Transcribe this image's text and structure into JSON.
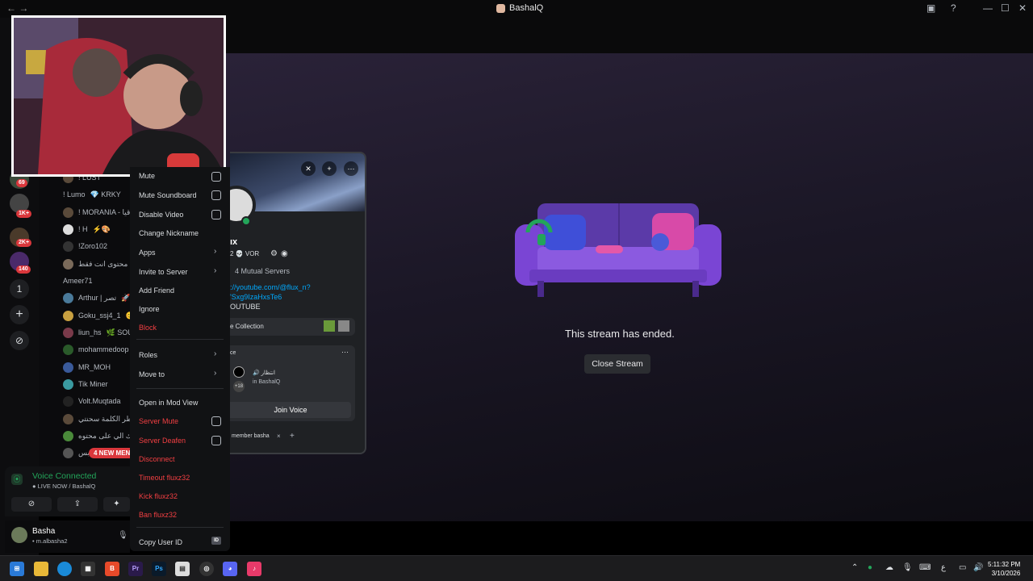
{
  "window": {
    "title": "BashalQ",
    "nav_back": "←",
    "nav_fwd": "→",
    "help": "?",
    "minimize": "—",
    "maximize": "☐",
    "close": "✕"
  },
  "server_rail": {
    "badges": [
      "69",
      "1K+",
      "2K+",
      "140"
    ],
    "home_number": "1",
    "add": "+",
    "explore": "⊘"
  },
  "members": [
    {
      "name": "! LUST"
    },
    {
      "name": "! Lumo",
      "tag": "💎 KRKY"
    },
    {
      "name": "! MORANIA - الاقيا"
    },
    {
      "name": "! H",
      "tag": "⚡🎨"
    },
    {
      "name": "!Zoro102"
    },
    {
      "name": "محتوى انت فقط <_>"
    },
    {
      "name": "Ameer71"
    },
    {
      "name": "Arthur | تصر",
      "tag": "🚀"
    },
    {
      "name": "Goku_ssj4_1",
      "tag": "😊"
    },
    {
      "name": "liun_hs",
      "tag": "🌿 SOUL"
    },
    {
      "name": "mohammedoop"
    },
    {
      "name": "MR_MOH"
    },
    {
      "name": "Tik Miner"
    },
    {
      "name": "Volt.Muqtada"
    },
    {
      "name": "خاطر الكلمة سحنتي"
    },
    {
      "name": "نوبكاك الي على محتوه"
    },
    {
      "name": "بس"
    }
  ],
  "new_mentions": "4 NEW MENT",
  "voice": {
    "status": "Voice Connected",
    "channel": "● LIVE NOW / BashalQ"
  },
  "user": {
    "name": "Basha",
    "tag": "• m.albasha2"
  },
  "stream": {
    "ended_text": "This stream has ended.",
    "close_button": "Close Stream"
  },
  "profile": {
    "name": "ıx",
    "badges": "2  💀 VOR",
    "mutual": "4 Mutual Servers",
    "link1": "://youtube.com/@flux_n?",
    "link2": "'Sxg9IzaHxsTe6",
    "text3": "OUTUBE",
    "collection": "e Collection",
    "voice_section": "ce",
    "voice_user": "🔊 انتظار",
    "voice_in": "in BashalQ",
    "voice_count": "+18",
    "join_voice": "Join Voice",
    "note": "member basha",
    "note_x": "×",
    "note_add": "+"
  },
  "context_menu": {
    "mute": "Mute",
    "mute_soundboard": "Mute Soundboard",
    "disable_video": "Disable Video",
    "change_nickname": "Change Nickname",
    "apps": "Apps",
    "invite_to_server": "Invite to Server",
    "add_friend": "Add Friend",
    "ignore": "Ignore",
    "block": "Block",
    "roles": "Roles",
    "move_to": "Move to",
    "open_in_mod_view": "Open in Mod View",
    "server_mute": "Server Mute",
    "server_deafen": "Server Deafen",
    "disconnect": "Disconnect",
    "timeout": "Timeout fluxz32",
    "kick": "Kick fluxz32",
    "ban": "Ban fluxz32",
    "copy_user_id": "Copy User ID",
    "id_badge": "ID"
  },
  "taskbar": {
    "clock_time": "5:11:32 PM",
    "clock_date": "3/10/2026",
    "lang": "ع"
  },
  "colors": {
    "accent_red": "#f23f42",
    "online_green": "#23a55a",
    "link_blue": "#00a8fc"
  }
}
